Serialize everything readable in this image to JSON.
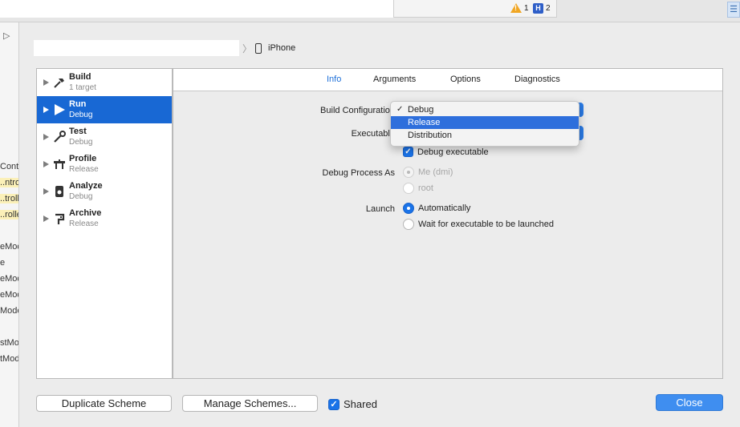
{
  "topbar": {
    "warnings": "1",
    "errors": "2"
  },
  "navigator": {
    "fragments": [
      {
        "text": "Contr",
        "yellow": false
      },
      {
        "text": "..ntrol",
        "yellow": true
      },
      {
        "text": "..trolle",
        "yellow": true
      },
      {
        "text": "..rolle",
        "yellow": true
      },
      {
        "text": "eMode",
        "yellow": false
      },
      {
        "text": "e",
        "yellow": false
      },
      {
        "text": "eMod",
        "yellow": false
      },
      {
        "text": "eMod",
        "yellow": false
      },
      {
        "text": "Model",
        "yellow": false
      },
      {
        "text": "stMod",
        "yellow": false
      },
      {
        "text": "tMod",
        "yellow": false
      }
    ]
  },
  "scheme": {
    "destination": "iPhone"
  },
  "actions": [
    {
      "name": "Build",
      "sub": "1 target",
      "icon": "hammer-icon"
    },
    {
      "name": "Run",
      "sub": "Debug",
      "icon": "play-icon"
    },
    {
      "name": "Test",
      "sub": "Debug",
      "icon": "wrench-icon"
    },
    {
      "name": "Profile",
      "sub": "Release",
      "icon": "profile-icon"
    },
    {
      "name": "Analyze",
      "sub": "Debug",
      "icon": "analyze-icon"
    },
    {
      "name": "Archive",
      "sub": "Release",
      "icon": "archive-icon"
    }
  ],
  "tabs": [
    "Info",
    "Arguments",
    "Options",
    "Diagnostics"
  ],
  "info": {
    "build_config_label": "Build Configuration",
    "executable_label": "Executable",
    "debug_exec_label": "Debug executable",
    "debug_process_label": "Debug Process As",
    "debug_process_opt1": "Me (dmi)",
    "debug_process_opt2": "root",
    "launch_label": "Launch",
    "launch_opt1": "Automatically",
    "launch_opt2": "Wait for executable to be launched"
  },
  "config_menu": {
    "items": [
      "Debug",
      "Release",
      "Distribution"
    ],
    "checked": "Debug",
    "highlighted": "Release"
  },
  "footer": {
    "duplicate": "Duplicate Scheme",
    "manage": "Manage Schemes...",
    "shared": "Shared",
    "close": "Close"
  },
  "colors": {
    "accent": "#1868d4",
    "highlight": "#2e6fdc"
  }
}
